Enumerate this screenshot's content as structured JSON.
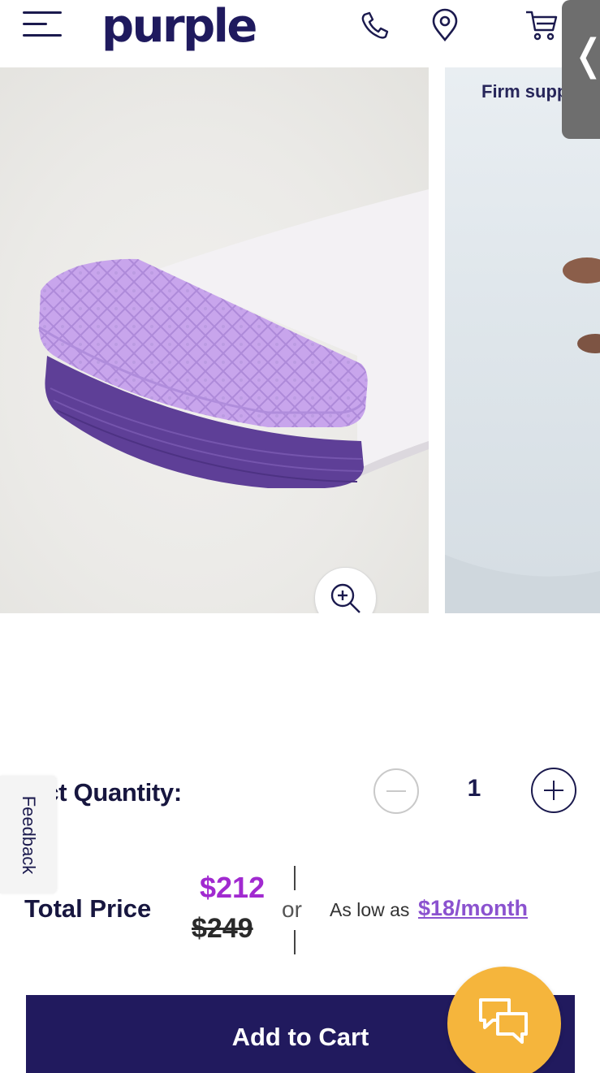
{
  "header": {
    "logo": "purple",
    "icons": [
      "menu-icon",
      "phone-icon",
      "location-pin-icon",
      "cart-icon"
    ]
  },
  "carousel": {
    "slide2_caption": "Firm supp",
    "zoom_icon": "zoom-in-icon",
    "side_tab_glyph": "❬"
  },
  "feedback": {
    "label": "Feedback"
  },
  "quantity": {
    "label": "lect Quantity:",
    "value": "1"
  },
  "price": {
    "label": "Total Price",
    "sale": "$212",
    "original": "$249",
    "or": "or",
    "as_low_as": "As low as",
    "monthly": "$18/month"
  },
  "cart": {
    "button_label": "Add to Cart"
  },
  "colors": {
    "brand": "#1f1a5e",
    "sale_price": "#a12ad0",
    "monthly_link": "#8b52cf",
    "cart_button": "#211a5e",
    "chat_button": "#f5b53c"
  }
}
